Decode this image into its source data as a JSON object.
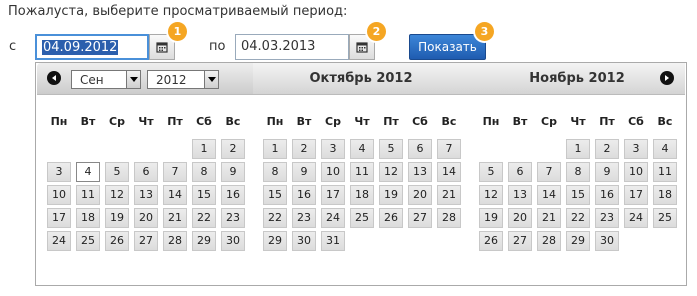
{
  "prompt": "Пожалуста, выберите просматриваемый период:",
  "from_label": "с",
  "to_label": "по",
  "from_date": "04.09.2012",
  "to_date": "04.03.2013",
  "show_button": "Показать",
  "badges": [
    "1",
    "2",
    "3"
  ],
  "colors": {
    "badge": "#f5a623",
    "button": "#2b6cc4",
    "selection": "#2b5fad"
  },
  "calendar": {
    "month_select": "Сен",
    "year_select": "2012",
    "weekdays": [
      "Пн",
      "Вт",
      "Ср",
      "Чт",
      "Пт",
      "Сб",
      "Вс"
    ],
    "months": [
      {
        "title": "",
        "start": 5,
        "days": 30,
        "today": 4
      },
      {
        "title": "Октябрь 2012",
        "start": 0,
        "days": 31,
        "today": null
      },
      {
        "title": "Ноябрь 2012",
        "start": 3,
        "days": 30,
        "today": null
      }
    ]
  }
}
